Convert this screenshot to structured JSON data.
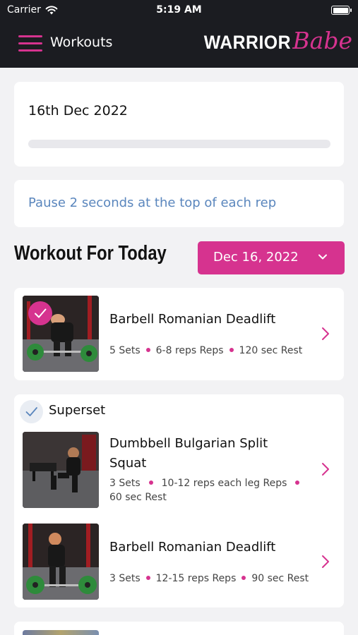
{
  "status_bar": {
    "carrier": "Carrier",
    "time": "5:19 AM"
  },
  "nav": {
    "title": "Workouts",
    "logo_primary": "WARRIOR",
    "logo_script": "Babe"
  },
  "day_card": {
    "date": "16th Dec 2022",
    "progress": 0
  },
  "note": "Pause 2 seconds at the top of each rep",
  "section_title": "Workout For Today",
  "date_selector": {
    "value": "Dec 16, 2022"
  },
  "exercises": [
    {
      "name": "Barbell Romanian Deadlift",
      "sets": "5 Sets",
      "reps": "6-8 reps Reps",
      "rest": "120 sec Rest",
      "completed": true
    }
  ],
  "superset": {
    "label": "Superset",
    "exercises": [
      {
        "name_line1": "Dumbbell Bulgarian Split",
        "name_line2": "Squat",
        "sets": "3 Sets",
        "reps": "10-12 reps each leg Reps",
        "rest": "60 sec Rest"
      },
      {
        "name": "Barbell Romanian Deadlift",
        "sets": "3 Sets",
        "reps": "12-15 reps Reps",
        "rest": "90 sec Rest"
      }
    ]
  },
  "colors": {
    "accent": "#d6338f",
    "header_bg": "#1b1c21",
    "note_text": "#5a86bd",
    "page_bg": "#f2f2f4"
  },
  "icons": [
    "wifi-icon",
    "battery-icon",
    "hamburger-menu-icon",
    "chevron-down-icon",
    "chevron-right-icon",
    "checkmark-icon"
  ]
}
